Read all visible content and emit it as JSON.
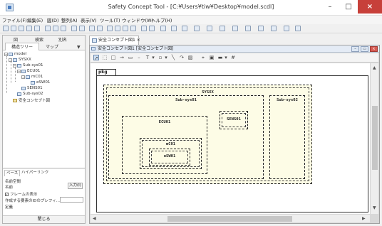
{
  "window": {
    "title": "Safety Concept Tool - [C:¥Users¥tiw¥Desktop¥model.scdl]",
    "controls": {
      "minimize": "–",
      "maximize": "□",
      "close": "×"
    }
  },
  "menubar": {
    "items": [
      "ファイル(F)",
      "編集(E)",
      "図(D)",
      "整列(A)",
      "表示(V)",
      "ツール(T)",
      "ウィンドウ(W)",
      "ヘルプ(H)"
    ]
  },
  "left_panel": {
    "tabs": [
      "図",
      "検索",
      "別名",
      "構造ツリー",
      "マップ"
    ],
    "tree": {
      "items": [
        {
          "label": "model",
          "depth": 0,
          "icon": "model-icon"
        },
        {
          "label": "SYSXX",
          "depth": 1,
          "icon": "block-icon"
        },
        {
          "label": "Sub-sys01",
          "depth": 2,
          "icon": "block-icon"
        },
        {
          "label": "ECU01",
          "depth": 3,
          "icon": "block-icon"
        },
        {
          "label": "mC01",
          "depth": 4,
          "icon": "block-icon"
        },
        {
          "label": "eSW01",
          "depth": 5,
          "icon": "block-icon"
        },
        {
          "label": "SENS01",
          "depth": 3,
          "icon": "block-icon"
        },
        {
          "label": "Sub-sys02",
          "depth": 2,
          "icon": "block-icon"
        },
        {
          "label": "安全コンセプト図",
          "depth": 1,
          "icon": "diagram-icon"
        }
      ]
    },
    "properties": {
      "tabs": [
        "ベース",
        "ハイパーリンク"
      ],
      "rows": [
        "名前空間",
        "名前",
        "フレームの表示",
        "作成する要素のIDのプレフィ...",
        "定義"
      ],
      "input_button": "入力(I)",
      "frame_checked": true
    },
    "close_label": "閉じる"
  },
  "document": {
    "tab_label": "安全コンセプト図1",
    "tab_close": "×",
    "window_title": "安全コンセプト図1 [安全コンセプト図]",
    "palette_icons": [
      "pointer-icon",
      "select-icon",
      "block-tool-icon",
      "arrow-icon",
      "frame-icon",
      "line-icon",
      "text-icon",
      "dropdown-icon",
      "stamp-icon",
      "dropdown-icon",
      "polyline-icon",
      "curve-icon",
      "image-icon",
      "pin-icon",
      "port-icon",
      "fill-icon",
      "dropdown-icon",
      "grid-icon"
    ]
  },
  "diagram": {
    "package_label": "pkg",
    "blocks": {
      "sysxx": "SYSXX",
      "subsys01": "Sub-sys01",
      "subsys02": "Sub-sys02",
      "ecu01": "ECU01",
      "sens01": "SENS01",
      "mc01": "mC01",
      "esw01": "eSW01"
    }
  }
}
